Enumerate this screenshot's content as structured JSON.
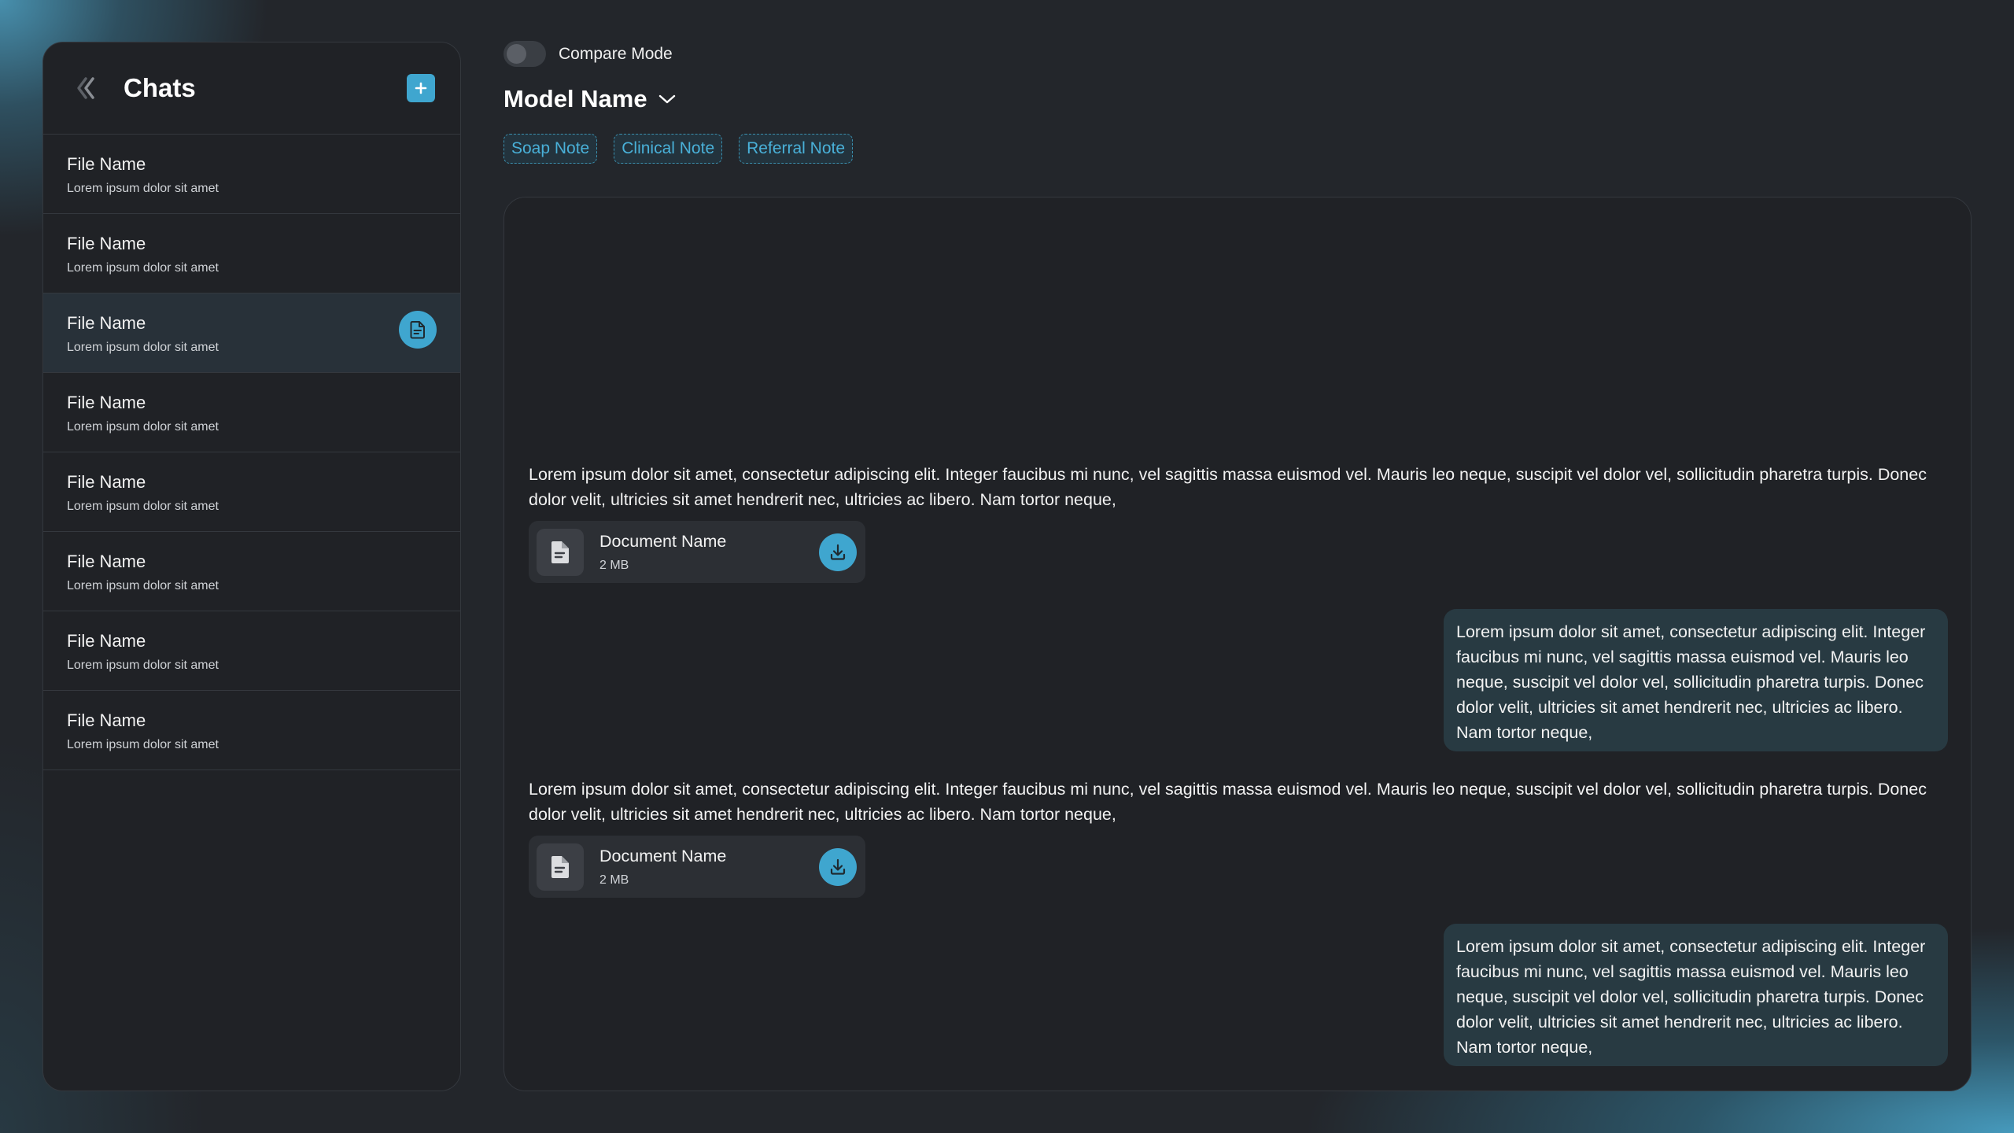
{
  "sidebar": {
    "title": "Chats",
    "items": [
      {
        "name": "File Name",
        "subtitle": "Lorem ipsum dolor sit amet"
      },
      {
        "name": "File Name",
        "subtitle": "Lorem ipsum dolor sit amet"
      },
      {
        "name": "File Name",
        "subtitle": "Lorem ipsum dolor sit amet",
        "active": true
      },
      {
        "name": "File Name",
        "subtitle": "Lorem ipsum dolor sit amet"
      },
      {
        "name": "File Name",
        "subtitle": "Lorem ipsum dolor sit amet"
      },
      {
        "name": "File Name",
        "subtitle": "Lorem ipsum dolor sit amet"
      },
      {
        "name": "File Name",
        "subtitle": "Lorem ipsum dolor sit amet"
      },
      {
        "name": "File Name",
        "subtitle": "Lorem ipsum dolor sit amet"
      }
    ]
  },
  "header": {
    "compare_label": "Compare Mode",
    "compare_enabled": false,
    "model_name": "Model Name"
  },
  "tags": [
    "Soap Note",
    "Clinical Note",
    "Referral Note"
  ],
  "messages": [
    {
      "role": "assistant",
      "text": "Lorem ipsum dolor sit amet, consectetur adipiscing elit. Integer faucibus mi nunc, vel sagittis massa euismod vel. Mauris leo neque, suscipit vel dolor vel, sollicitudin pharetra turpis. Donec dolor velit, ultricies sit amet hendrerit nec, ultricies ac libero. Nam tortor neque,",
      "attachment": {
        "name": "Document Name",
        "size": "2 MB"
      }
    },
    {
      "role": "user",
      "text": "Lorem ipsum dolor sit amet, consectetur adipiscing elit. Integer faucibus mi nunc, vel sagittis massa euismod vel. Mauris leo neque, suscipit vel dolor vel, sollicitudin pharetra turpis. Donec dolor velit, ultricies sit amet hendrerit nec, ultricies ac libero. Nam tortor neque,"
    },
    {
      "role": "assistant",
      "text": "Lorem ipsum dolor sit amet, consectetur adipiscing elit. Integer faucibus mi nunc, vel sagittis massa euismod vel. Mauris leo neque, suscipit vel dolor vel, sollicitudin pharetra turpis. Donec dolor velit, ultricies sit amet hendrerit nec, ultricies ac libero. Nam tortor neque,",
      "attachment": {
        "name": "Document Name",
        "size": "2 MB"
      }
    },
    {
      "role": "user",
      "text": "Lorem ipsum dolor sit amet, consectetur adipiscing elit. Integer faucibus mi nunc, vel sagittis massa euismod vel. Mauris leo neque, suscipit vel dolor vel, sollicitudin pharetra turpis. Donec dolor velit, ultricies sit amet hendrerit nec, ultricies ac libero. Nam tortor neque,"
    }
  ],
  "icons": {
    "back": "double-chevron-left-icon",
    "new_chat": "plus-icon",
    "chat_document": "document-icon",
    "model_dropdown": "chevron-down-icon",
    "attachment": "file-icon",
    "download": "download-icon"
  },
  "colors": {
    "accent": "#3fa6cf",
    "background": "#23262b",
    "panel": "#202226",
    "user_bubble": "#283a42",
    "tag_text": "#49b0d8"
  }
}
